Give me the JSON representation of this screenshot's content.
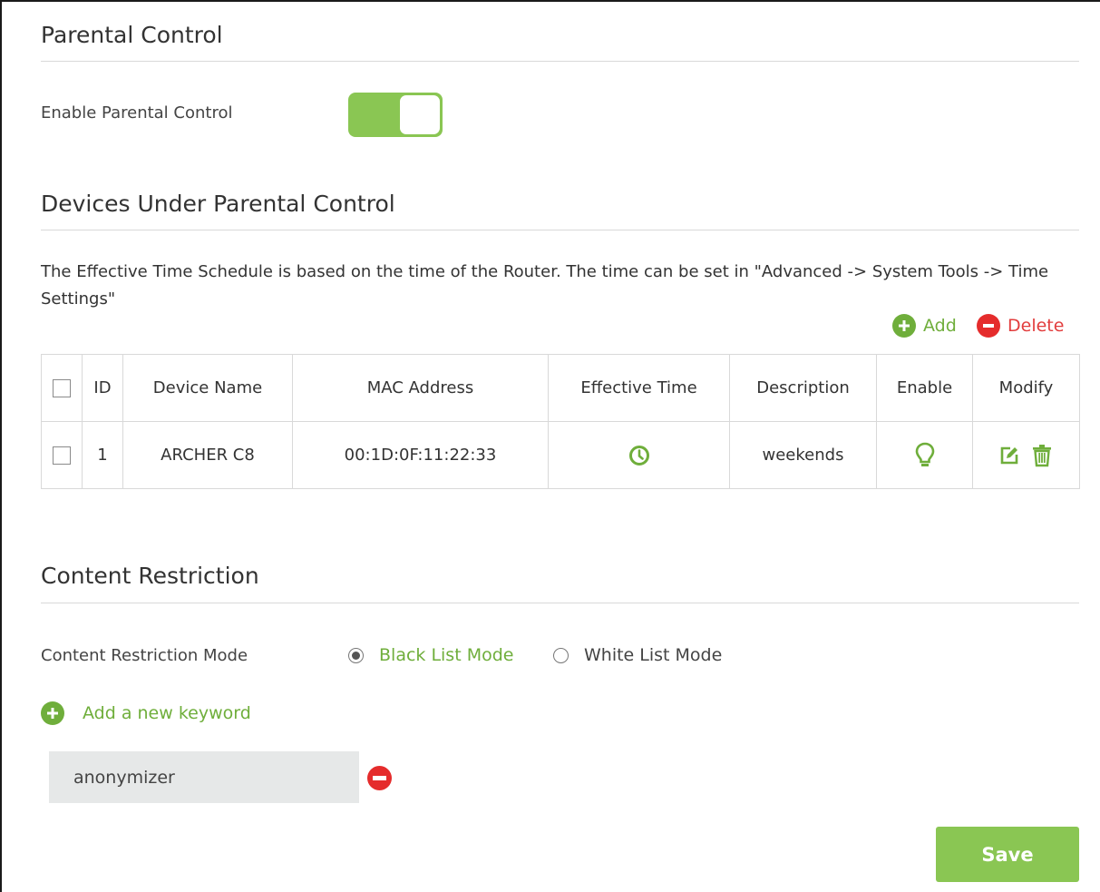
{
  "parental": {
    "title": "Parental Control",
    "enable_label": "Enable Parental Control",
    "enabled": true
  },
  "devices": {
    "title": "Devices Under Parental Control",
    "description": "The Effective Time Schedule is based on the time of the Router. The time can be set in \"Advanced -> System Tools -> Time Settings\"",
    "add_label": "Add",
    "delete_label": "Delete",
    "columns": [
      "ID",
      "Device Name",
      "MAC Address",
      "Effective Time",
      "Description",
      "Enable",
      "Modify"
    ],
    "rows": [
      {
        "id": "1",
        "device_name": "ARCHER C8",
        "mac": "00:1D:0F:11:22:33",
        "effective_time_icon": "clock-icon",
        "description": "weekends",
        "enable_icon": "lightbulb-icon",
        "modify_icons": [
          "edit-icon",
          "trash-icon"
        ]
      }
    ]
  },
  "content": {
    "title": "Content Restriction",
    "mode_label": "Content Restriction Mode",
    "modes": [
      {
        "label": "Black List Mode",
        "selected": true
      },
      {
        "label": "White List Mode",
        "selected": false
      }
    ],
    "add_keyword_label": "Add a new keyword",
    "keywords": [
      "anonymizer"
    ]
  },
  "save_label": "Save",
  "colors": {
    "accent_green": "#8ac653",
    "link_green": "#6fae3b",
    "delete_red": "#e52c2c"
  }
}
